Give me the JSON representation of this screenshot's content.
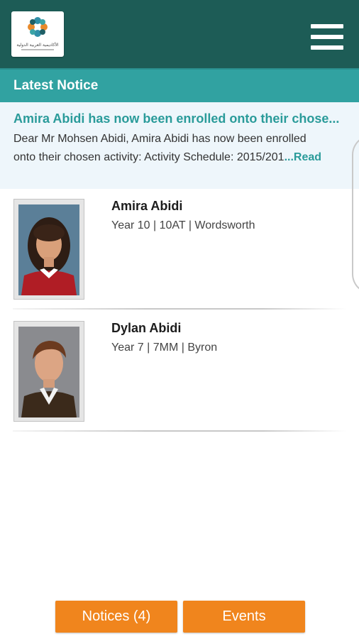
{
  "header": {
    "logo_caption": "الأكاديمية العربية الدولية",
    "menu_icon": "hamburger-menu-icon"
  },
  "latest_notice": {
    "section_title": "Latest Notice",
    "title": "Amira Abidi has now been enrolled onto their chose...",
    "body_line1": "Dear Mr Mohsen Abidi, Amira Abidi has now been enrolled",
    "body_line2": "onto their chosen activity: Activity Schedule: 2015/201",
    "read_more": "...Read"
  },
  "students": [
    {
      "name": "Amira Abidi",
      "details": "Year 10 | 10AT | Wordsworth"
    },
    {
      "name": "Dylan Abidi",
      "details": "Year 7 | 7MM | Byron"
    }
  ],
  "footer": {
    "notices_label": "Notices (4)",
    "events_label": "Events"
  },
  "colors": {
    "appbar": "#1d5c56",
    "section_bar": "#31a2a1",
    "accent_text": "#2a9b9a",
    "button": "#f0851d"
  }
}
